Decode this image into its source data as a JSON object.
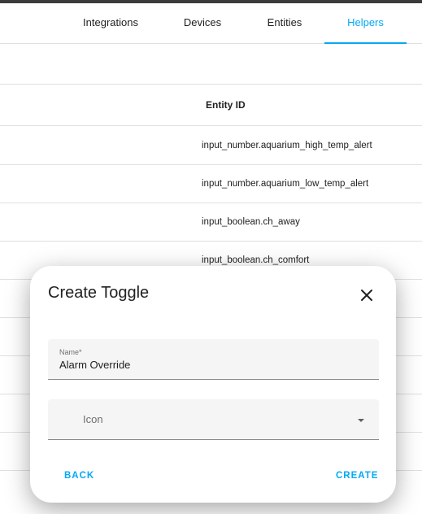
{
  "tabs": [
    {
      "label": "Integrations"
    },
    {
      "label": "Devices"
    },
    {
      "label": "Entities"
    },
    {
      "label": "Helpers"
    }
  ],
  "table": {
    "column_header": "Entity ID",
    "rows": [
      "input_number.aquarium_high_temp_alert",
      "input_number.aquarium_low_temp_alert",
      "input_boolean.ch_away",
      "input_boolean.ch_comfort",
      "",
      "",
      "",
      "",
      ""
    ]
  },
  "dialog": {
    "title": "Create Toggle",
    "name_label": "Name*",
    "name_value": "Alarm Override",
    "icon_label": "Icon",
    "back_label": "BACK",
    "create_label": "CREATE"
  },
  "colors": {
    "accent": "#03a9f4",
    "text": "#212121",
    "divider": "#e0e0e0"
  },
  "icons": {
    "close": "close-icon",
    "dropdown": "chevron-down-icon"
  }
}
